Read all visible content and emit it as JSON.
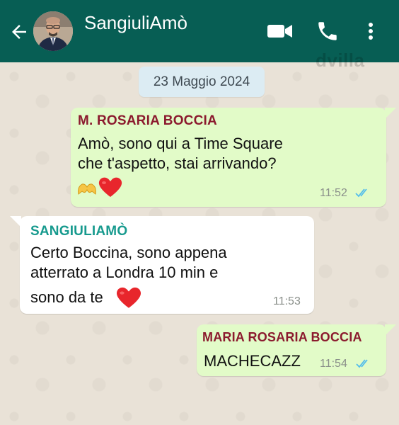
{
  "header": {
    "contact_name": "SangiuliAmò",
    "watermark": "dvilla",
    "icons": [
      "back-arrow-icon",
      "avatar",
      "video-call-icon",
      "phone-call-icon",
      "more-menu-icon"
    ],
    "bar_color": "#075e54"
  },
  "chat": {
    "date_chip": "23 Maggio 2024",
    "messages": [
      {
        "direction": "outgoing",
        "sender": "M. ROSARIA BOCCIA",
        "line1": "Amò, sono qui a Time Square",
        "line2": "che t'aspetto, stai arrivando?",
        "emoji": [
          "hands-heart-icon",
          "red-heart-icon"
        ],
        "time": "11:52",
        "status": "read-double-check-icon"
      },
      {
        "direction": "incoming",
        "sender": "SANGIULIAMÒ",
        "line1": "Certo Boccina, sono appena",
        "line2": "atterrato a Londra 10 min e",
        "line3": "sono da te",
        "emoji": [
          "red-heart-icon"
        ],
        "time": "11:53"
      },
      {
        "direction": "outgoing",
        "sender": "MARIA ROSARIA BOCCIA",
        "text": "MACHECAZZ",
        "time": "11:54",
        "status": "read-double-check-icon"
      }
    ]
  },
  "colors": {
    "outgoing_bubble": "#e2fbc8",
    "incoming_bubble": "#ffffff",
    "sender_maroon": "#8b1a2e",
    "sender_teal": "#179a8e",
    "read_ticks": "#53bdeb"
  }
}
